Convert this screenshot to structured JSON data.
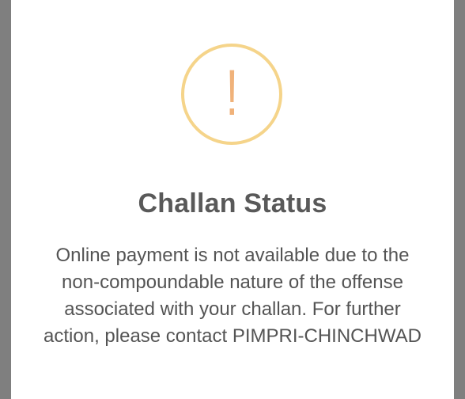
{
  "dialog": {
    "icon": "exclamation-warning-icon",
    "icon_glyph": "!",
    "title": "Challan Status",
    "message": "Online payment is not available due to the non-compoundable nature of the offense associated with your challan. For further action, please contact PIMPRI-CHINCHWAD"
  },
  "colors": {
    "backdrop": "#7f7f7f",
    "modal_background": "#ffffff",
    "icon_ring": "#f5d48a",
    "icon_mark": "#f0b27a",
    "title_text": "#595959",
    "body_text": "#545454"
  }
}
